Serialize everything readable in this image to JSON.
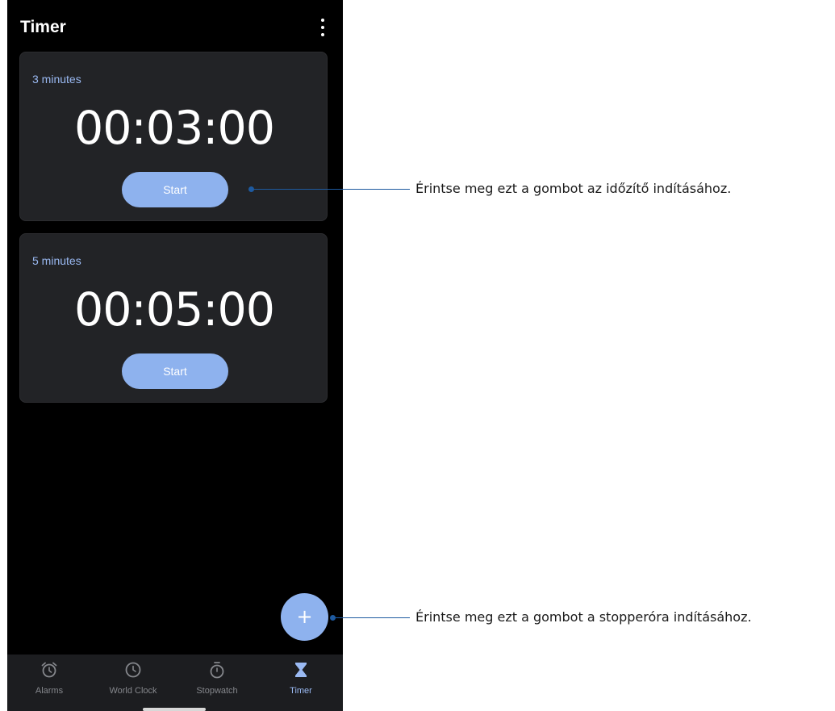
{
  "appbar": {
    "title": "Timer",
    "menu_icon": "more-vert-icon"
  },
  "timers": [
    {
      "label": "3 minutes",
      "time": "00:03:00",
      "start_label": "Start"
    },
    {
      "label": "5 minutes",
      "time": "00:05:00",
      "start_label": "Start"
    }
  ],
  "fab": {
    "label": "+",
    "icon": "add-icon"
  },
  "bottom_nav": {
    "items": [
      {
        "label": "Alarms",
        "icon": "alarm-clock-icon",
        "active": false
      },
      {
        "label": "World Clock",
        "icon": "clock-icon",
        "active": false
      },
      {
        "label": "Stopwatch",
        "icon": "stopwatch-icon",
        "active": false
      },
      {
        "label": "Timer",
        "icon": "hourglass-icon",
        "active": true
      }
    ]
  },
  "callouts": {
    "start": "Érintse meg ezt a gombot az időzítő indításához.",
    "add": "Érintse meg ezt a gombot a stopperóra indításához."
  },
  "colors": {
    "accent": "#8eb2ee",
    "label_accent": "#9ab9f2",
    "card_bg": "#222326",
    "screen_bg": "#000000",
    "nav_bg": "#1c1d20",
    "callout_line": "#1e5aa0"
  }
}
